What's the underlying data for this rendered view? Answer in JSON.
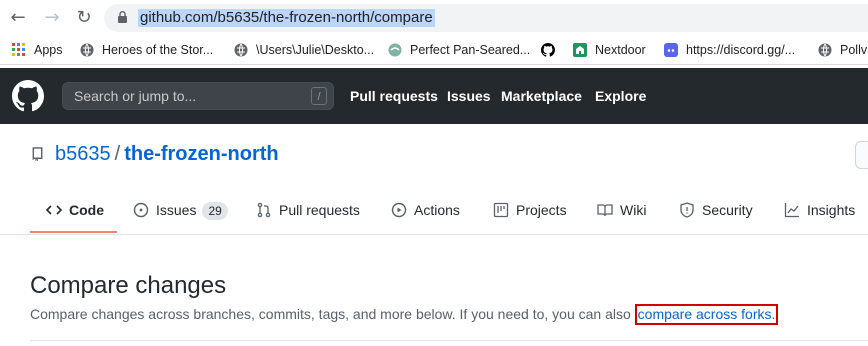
{
  "browser": {
    "url": "github.com/b5635/the-frozen-north/compare",
    "bookmarks": [
      {
        "label": "Apps",
        "icon": "apps-grid-icon"
      },
      {
        "label": "Heroes of the Stor...",
        "icon": "globe-icon"
      },
      {
        "label": "\\Users\\Julie\\Deskto...",
        "icon": "globe-icon"
      },
      {
        "label": "Perfect Pan-Seared...",
        "icon": "site-icon"
      },
      {
        "label": "",
        "icon": "github-icon"
      },
      {
        "label": "Nextdoor",
        "icon": "nextdoor-icon"
      },
      {
        "label": "https://discord.gg/...",
        "icon": "discord-icon"
      },
      {
        "label": "Pollv",
        "icon": "globe-icon"
      }
    ]
  },
  "gh": {
    "search_placeholder": "Search or jump to...",
    "search_key": "/",
    "nav": [
      "Pull requests",
      "Issues",
      "Marketplace",
      "Explore"
    ]
  },
  "repo": {
    "owner": "b5635",
    "separator": "/",
    "name": "the-frozen-north",
    "tabs": [
      {
        "label": "Code",
        "icon": "code-icon"
      },
      {
        "label": "Issues",
        "icon": "issue-icon",
        "count": "29"
      },
      {
        "label": "Pull requests",
        "icon": "pull-request-icon"
      },
      {
        "label": "Actions",
        "icon": "play-icon"
      },
      {
        "label": "Projects",
        "icon": "project-icon"
      },
      {
        "label": "Wiki",
        "icon": "book-icon"
      },
      {
        "label": "Security",
        "icon": "shield-icon"
      },
      {
        "label": "Insights",
        "icon": "graph-icon"
      }
    ]
  },
  "compare": {
    "title": "Compare changes",
    "description": "Compare changes across branches, commits, tags, and more below. If you need to, you can also ",
    "link": "compare across forks",
    "suffix": "."
  },
  "colors": {
    "header_bg": "#24292e",
    "link": "#0366d6",
    "active_tab_underline": "#f9826c",
    "highlight_box": "#d40000"
  }
}
